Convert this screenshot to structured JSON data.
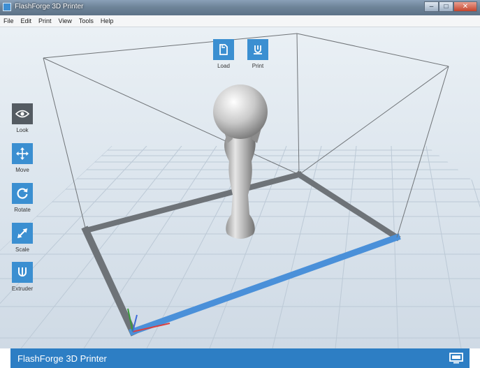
{
  "window": {
    "title": "FlashForge 3D Printer",
    "buttons": [
      "–",
      "□",
      "✕"
    ]
  },
  "menu": [
    "File",
    "Edit",
    "Print",
    "View",
    "Tools",
    "Help"
  ],
  "top_toolbar": [
    {
      "label": "Load",
      "icon": "load-file-icon"
    },
    {
      "label": "Print",
      "icon": "print-icon"
    }
  ],
  "left_toolbar": [
    {
      "label": "Look",
      "icon": "eye-icon",
      "active": true
    },
    {
      "label": "Move",
      "icon": "move-arrows-icon"
    },
    {
      "label": "Rotate",
      "icon": "rotate-icon"
    },
    {
      "label": "Scale",
      "icon": "scale-arrow-icon"
    },
    {
      "label": "Extruder",
      "icon": "extruder-icon"
    }
  ],
  "status_bar": {
    "title": "FlashForge 3D Printer",
    "icon": "printer-device-icon"
  },
  "colors": {
    "accent": "#3b8fd1",
    "active_tool": "#545b62",
    "status_bar": "#2d7ec4",
    "platform_blue": "#4a90d9",
    "platform_gray": "#6e7378"
  }
}
